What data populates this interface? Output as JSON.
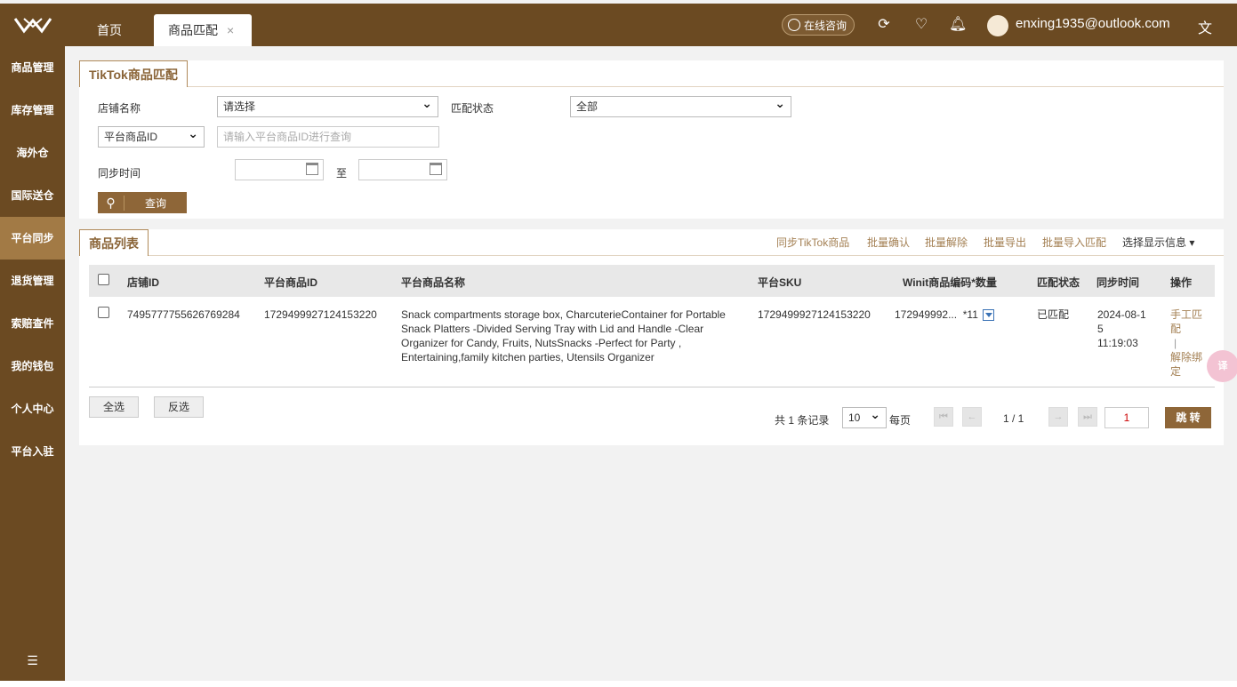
{
  "header": {
    "tabs": [
      {
        "label": "首页"
      },
      {
        "label": "商品匹配",
        "close": "×"
      }
    ],
    "consult_label": "在线咨询",
    "user_email": "enxing1935@outlook.com",
    "brand_color": "#6b4a22"
  },
  "sidebar": {
    "items": [
      {
        "label": "商品管理"
      },
      {
        "label": "库存管理"
      },
      {
        "label": "海外仓"
      },
      {
        "label": "国际送仓"
      },
      {
        "label": "平台同步",
        "active": true
      },
      {
        "label": "退货管理"
      },
      {
        "label": "索赔查件"
      },
      {
        "label": "我的钱包"
      },
      {
        "label": "个人中心"
      },
      {
        "label": "平台入驻"
      }
    ]
  },
  "filter": {
    "tab_label": "TikTok商品匹配",
    "store_label": "店铺名称",
    "store_value": "请选择",
    "status_label": "匹配状态",
    "status_value": "全部",
    "id_type_value": "平台商品ID",
    "id_placeholder": "请输入平台商品ID进行查询",
    "sync_time_label": "同步时间",
    "to_label": "至",
    "query_label": "查询"
  },
  "list": {
    "tab_label": "商品列表",
    "actions": {
      "sync": "同步TikTok商品",
      "batch_confirm": "批量确认",
      "batch_unbind": "批量解除",
      "batch_export": "批量导出",
      "batch_import": "批量导入匹配",
      "display_select": "选择显示信息 ▾"
    },
    "columns": {
      "store_id": "店铺ID",
      "platform_id": "平台商品ID",
      "platform_name": "平台商品名称",
      "platform_sku": "平台SKU",
      "winit_code": "Winit商品编码*数量",
      "match_status": "匹配状态",
      "sync_time": "同步时间",
      "operation": "操作"
    },
    "rows": [
      {
        "store_id": "7495777755626769284",
        "platform_id": "1729499927124153220",
        "name": "Snack compartments storage box, CharcuterieContainer for Portable Snack Platters -Divided Serving Tray with Lid and Handle -Clear Organizer for Candy, Fruits, NutsSnacks -Perfect for Party , Entertaining,family kitchen parties, Utensils Organizer",
        "sku": "1729499927124153220",
        "winit_code": "172949992...",
        "qty": "*11",
        "status": "已匹配",
        "sync_date": "2024-08-15",
        "sync_clock": "11:19:03",
        "op_manual": "手工匹配",
        "op_sep": "|",
        "op_unbind": "解除绑定"
      }
    ],
    "select_all": "全选",
    "invert": "反选"
  },
  "pagination": {
    "total": "共 1 条记录",
    "page_size": "10",
    "per_page": "每页",
    "page_info": "1 / 1",
    "page_input": "1",
    "jump": "跳 转"
  }
}
